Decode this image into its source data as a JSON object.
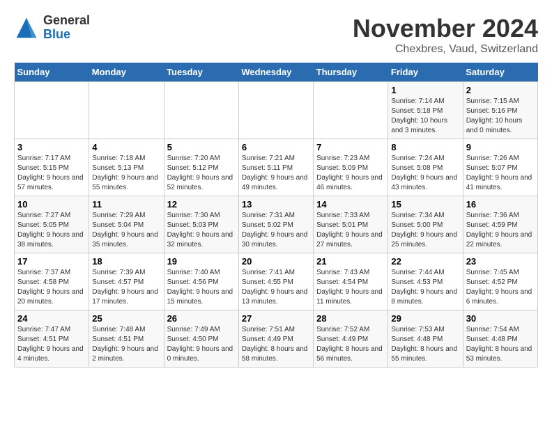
{
  "logo": {
    "general": "General",
    "blue": "Blue"
  },
  "title": "November 2024",
  "location": "Chexbres, Vaud, Switzerland",
  "weekdays": [
    "Sunday",
    "Monday",
    "Tuesday",
    "Wednesday",
    "Thursday",
    "Friday",
    "Saturday"
  ],
  "weeks": [
    [
      {
        "day": "",
        "info": ""
      },
      {
        "day": "",
        "info": ""
      },
      {
        "day": "",
        "info": ""
      },
      {
        "day": "",
        "info": ""
      },
      {
        "day": "",
        "info": ""
      },
      {
        "day": "1",
        "info": "Sunrise: 7:14 AM\nSunset: 5:18 PM\nDaylight: 10 hours and 3 minutes."
      },
      {
        "day": "2",
        "info": "Sunrise: 7:15 AM\nSunset: 5:16 PM\nDaylight: 10 hours and 0 minutes."
      }
    ],
    [
      {
        "day": "3",
        "info": "Sunrise: 7:17 AM\nSunset: 5:15 PM\nDaylight: 9 hours and 57 minutes."
      },
      {
        "day": "4",
        "info": "Sunrise: 7:18 AM\nSunset: 5:13 PM\nDaylight: 9 hours and 55 minutes."
      },
      {
        "day": "5",
        "info": "Sunrise: 7:20 AM\nSunset: 5:12 PM\nDaylight: 9 hours and 52 minutes."
      },
      {
        "day": "6",
        "info": "Sunrise: 7:21 AM\nSunset: 5:11 PM\nDaylight: 9 hours and 49 minutes."
      },
      {
        "day": "7",
        "info": "Sunrise: 7:23 AM\nSunset: 5:09 PM\nDaylight: 9 hours and 46 minutes."
      },
      {
        "day": "8",
        "info": "Sunrise: 7:24 AM\nSunset: 5:08 PM\nDaylight: 9 hours and 43 minutes."
      },
      {
        "day": "9",
        "info": "Sunrise: 7:26 AM\nSunset: 5:07 PM\nDaylight: 9 hours and 41 minutes."
      }
    ],
    [
      {
        "day": "10",
        "info": "Sunrise: 7:27 AM\nSunset: 5:05 PM\nDaylight: 9 hours and 38 minutes."
      },
      {
        "day": "11",
        "info": "Sunrise: 7:29 AM\nSunset: 5:04 PM\nDaylight: 9 hours and 35 minutes."
      },
      {
        "day": "12",
        "info": "Sunrise: 7:30 AM\nSunset: 5:03 PM\nDaylight: 9 hours and 32 minutes."
      },
      {
        "day": "13",
        "info": "Sunrise: 7:31 AM\nSunset: 5:02 PM\nDaylight: 9 hours and 30 minutes."
      },
      {
        "day": "14",
        "info": "Sunrise: 7:33 AM\nSunset: 5:01 PM\nDaylight: 9 hours and 27 minutes."
      },
      {
        "day": "15",
        "info": "Sunrise: 7:34 AM\nSunset: 5:00 PM\nDaylight: 9 hours and 25 minutes."
      },
      {
        "day": "16",
        "info": "Sunrise: 7:36 AM\nSunset: 4:59 PM\nDaylight: 9 hours and 22 minutes."
      }
    ],
    [
      {
        "day": "17",
        "info": "Sunrise: 7:37 AM\nSunset: 4:58 PM\nDaylight: 9 hours and 20 minutes."
      },
      {
        "day": "18",
        "info": "Sunrise: 7:39 AM\nSunset: 4:57 PM\nDaylight: 9 hours and 17 minutes."
      },
      {
        "day": "19",
        "info": "Sunrise: 7:40 AM\nSunset: 4:56 PM\nDaylight: 9 hours and 15 minutes."
      },
      {
        "day": "20",
        "info": "Sunrise: 7:41 AM\nSunset: 4:55 PM\nDaylight: 9 hours and 13 minutes."
      },
      {
        "day": "21",
        "info": "Sunrise: 7:43 AM\nSunset: 4:54 PM\nDaylight: 9 hours and 11 minutes."
      },
      {
        "day": "22",
        "info": "Sunrise: 7:44 AM\nSunset: 4:53 PM\nDaylight: 9 hours and 8 minutes."
      },
      {
        "day": "23",
        "info": "Sunrise: 7:45 AM\nSunset: 4:52 PM\nDaylight: 9 hours and 6 minutes."
      }
    ],
    [
      {
        "day": "24",
        "info": "Sunrise: 7:47 AM\nSunset: 4:51 PM\nDaylight: 9 hours and 4 minutes."
      },
      {
        "day": "25",
        "info": "Sunrise: 7:48 AM\nSunset: 4:51 PM\nDaylight: 9 hours and 2 minutes."
      },
      {
        "day": "26",
        "info": "Sunrise: 7:49 AM\nSunset: 4:50 PM\nDaylight: 9 hours and 0 minutes."
      },
      {
        "day": "27",
        "info": "Sunrise: 7:51 AM\nSunset: 4:49 PM\nDaylight: 8 hours and 58 minutes."
      },
      {
        "day": "28",
        "info": "Sunrise: 7:52 AM\nSunset: 4:49 PM\nDaylight: 8 hours and 56 minutes."
      },
      {
        "day": "29",
        "info": "Sunrise: 7:53 AM\nSunset: 4:48 PM\nDaylight: 8 hours and 55 minutes."
      },
      {
        "day": "30",
        "info": "Sunrise: 7:54 AM\nSunset: 4:48 PM\nDaylight: 8 hours and 53 minutes."
      }
    ]
  ]
}
